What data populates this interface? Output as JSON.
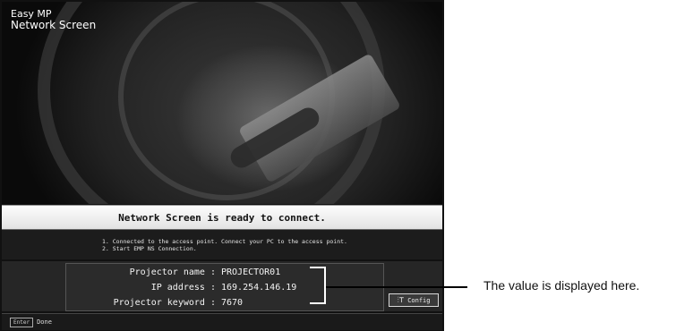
{
  "app": {
    "logo_line1": "Easy MP",
    "logo_line2": "Network Screen"
  },
  "status": {
    "message": "Network Screen is ready to connect."
  },
  "steps": [
    "1. Connected to the access point. Connect your PC to the access point.",
    "2. Start EMP NS Connection."
  ],
  "info": {
    "projector_name_label": "Projector name : ",
    "projector_name_value": "PROJECTOR01",
    "ip_label": "IP address : ",
    "ip_value": "169.254.146.19",
    "keyword_label": "Projector keyword : ",
    "keyword_value": "7670"
  },
  "config_button": {
    "label": "Config",
    "icon": "config-icon"
  },
  "footer": {
    "key_label": "Enter",
    "action_label": "Done"
  },
  "callout": {
    "text": "The value is displayed here."
  },
  "colors": {
    "screen_bg": "#111111",
    "status_bar": "#eeeeee",
    "callout_line": "#000000"
  }
}
